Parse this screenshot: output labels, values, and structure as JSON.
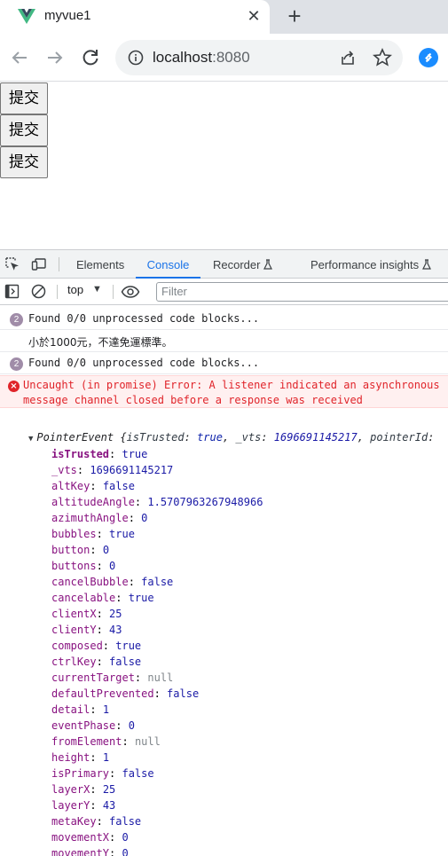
{
  "browser": {
    "tab_title": "myvue1",
    "tab_close_glyph": "✕",
    "new_tab_glyph": "+",
    "url_host": "localhost",
    "url_port": ":8080",
    "icons": [
      "vue-logo-icon",
      "close-icon",
      "plus-icon",
      "back-arrow-icon",
      "forward-arrow-icon",
      "reload-icon",
      "info-icon",
      "share-icon",
      "star-icon",
      "extension-icon"
    ]
  },
  "page": {
    "buttons": [
      "提交",
      "提交",
      "提交"
    ]
  },
  "devtools": {
    "tabs": [
      "Elements",
      "Console",
      "Recorder",
      "Performance insights"
    ],
    "active_tab": "Console",
    "context": "top",
    "filter_placeholder": "Filter",
    "messages": [
      {
        "kind": "info",
        "count": "2",
        "text": "Found 0/0 unprocessed code blocks..."
      },
      {
        "kind": "plain",
        "text": "小於1000元，不達免運標準。"
      },
      {
        "kind": "info",
        "count": "2",
        "text": "Found 0/0 unprocessed code blocks..."
      },
      {
        "kind": "error",
        "line1": "Uncaught (in promise) Error: A listener indicated an asynchronous response by returning true, but the",
        "line2": "message channel closed before a response was received"
      }
    ],
    "object": {
      "name": "PointerEvent",
      "summary_open": " {",
      "summary_k1": "isTrusted",
      "summary_v1": "true",
      "summary_k2": "_vts",
      "summary_v2": "1696691145217",
      "summary_k3": "pointerId",
      "props": [
        {
          "key": "isTrusted",
          "value": "true",
          "strong": true
        },
        {
          "key": "_vts",
          "value": "1696691145217"
        },
        {
          "key": "altKey",
          "value": "false"
        },
        {
          "key": "altitudeAngle",
          "value": "1.5707963267948966"
        },
        {
          "key": "azimuthAngle",
          "value": "0"
        },
        {
          "key": "bubbles",
          "value": "true"
        },
        {
          "key": "button",
          "value": "0"
        },
        {
          "key": "buttons",
          "value": "0"
        },
        {
          "key": "cancelBubble",
          "value": "false"
        },
        {
          "key": "cancelable",
          "value": "true"
        },
        {
          "key": "clientX",
          "value": "25"
        },
        {
          "key": "clientY",
          "value": "43"
        },
        {
          "key": "composed",
          "value": "true"
        },
        {
          "key": "ctrlKey",
          "value": "false"
        },
        {
          "key": "currentTarget",
          "value": "null"
        },
        {
          "key": "defaultPrevented",
          "value": "false"
        },
        {
          "key": "detail",
          "value": "1"
        },
        {
          "key": "eventPhase",
          "value": "0"
        },
        {
          "key": "fromElement",
          "value": "null"
        },
        {
          "key": "height",
          "value": "1"
        },
        {
          "key": "isPrimary",
          "value": "false"
        },
        {
          "key": "layerX",
          "value": "25"
        },
        {
          "key": "layerY",
          "value": "43"
        },
        {
          "key": "metaKey",
          "value": "false"
        },
        {
          "key": "movementX",
          "value": "0"
        },
        {
          "key": "movementY",
          "value": "0"
        }
      ]
    }
  }
}
